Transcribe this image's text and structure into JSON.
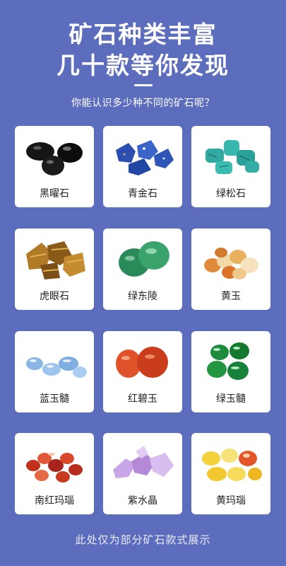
{
  "header": {
    "title_line1": "矿石种类丰富",
    "title_line2": "几十款等你发现",
    "subtitle": "你能认识多少种不同的矿石呢？"
  },
  "stones": [
    {
      "label": "黑曜石"
    },
    {
      "label": "青金石"
    },
    {
      "label": "绿松石"
    },
    {
      "label": "虎眼石"
    },
    {
      "label": "绿东陵"
    },
    {
      "label": "黄玉"
    },
    {
      "label": "蓝玉髓"
    },
    {
      "label": "红碧玉"
    },
    {
      "label": "绿玉髓"
    },
    {
      "label": "南红玛瑙"
    },
    {
      "label": "紫水晶"
    },
    {
      "label": "黄玛瑙"
    }
  ],
  "footer": {
    "note": "此处仅为部分矿石款式展示"
  },
  "colors": {
    "background": "#5d6dbd",
    "card": "#ffffff"
  }
}
